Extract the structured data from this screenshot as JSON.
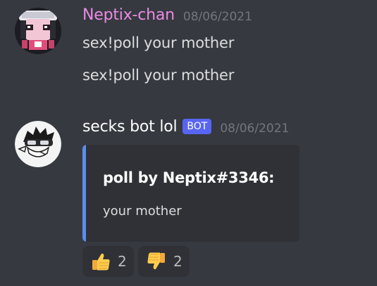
{
  "messages": [
    {
      "author": "Neptix-chan",
      "author_color": "#e98be6",
      "timestamp": "08/06/2021",
      "avatar_icon": "anime-character-avatar",
      "lines": [
        "sex!poll your mother",
        "sex!poll your mother"
      ]
    },
    {
      "author": "secks bot lol",
      "author_color": "#ffffff",
      "bot_tag": "BOT",
      "timestamp": "08/06/2021",
      "avatar_icon": "goggles-character-avatar",
      "embed": {
        "accent_color": "#5b8def",
        "title": "poll by Neptix#3346:",
        "description": "your mother"
      },
      "reactions": [
        {
          "emoji": "thumbs-up-icon",
          "count": "2"
        },
        {
          "emoji": "thumbs-down-icon",
          "count": "2"
        }
      ]
    }
  ],
  "theme": {
    "background": "#36393f",
    "embed_background": "#2f3136",
    "bot_tag_color": "#5865f2",
    "timestamp_color": "#72767d"
  }
}
